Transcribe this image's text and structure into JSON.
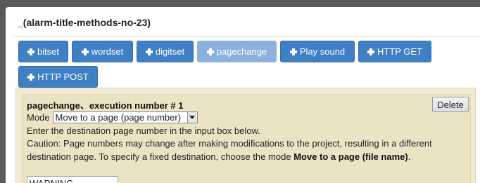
{
  "panel": {
    "title": "_(alarm-title-methods-no-23)"
  },
  "toolbar": {
    "buttons": [
      {
        "label": "bitset"
      },
      {
        "label": "wordset"
      },
      {
        "label": "digitset"
      },
      {
        "label": "pagechange"
      },
      {
        "label": "Play sound"
      },
      {
        "label": "HTTP GET"
      },
      {
        "label": "HTTP POST"
      }
    ]
  },
  "action": {
    "heading": "pagechange、execution number #  1",
    "delete_label": "Delete",
    "mode_label": "Mode",
    "mode_selected": "Move to a page (page number)",
    "line1": "Enter the destination page number in the input box below.",
    "line2": "Caution: Page numbers may change after making modifications to the project, resulting in a different",
    "line3_prefix": "destination page. To specify a fixed destination, choose the mode ",
    "line3_bold": "Move to a page (file name)",
    "line3_suffix": ".",
    "input_value": "WARNING"
  },
  "colors": {
    "button_blue": "#3f7fc4",
    "button_disabled": "#8bb1dc",
    "action_bg": "#ece3c4"
  }
}
